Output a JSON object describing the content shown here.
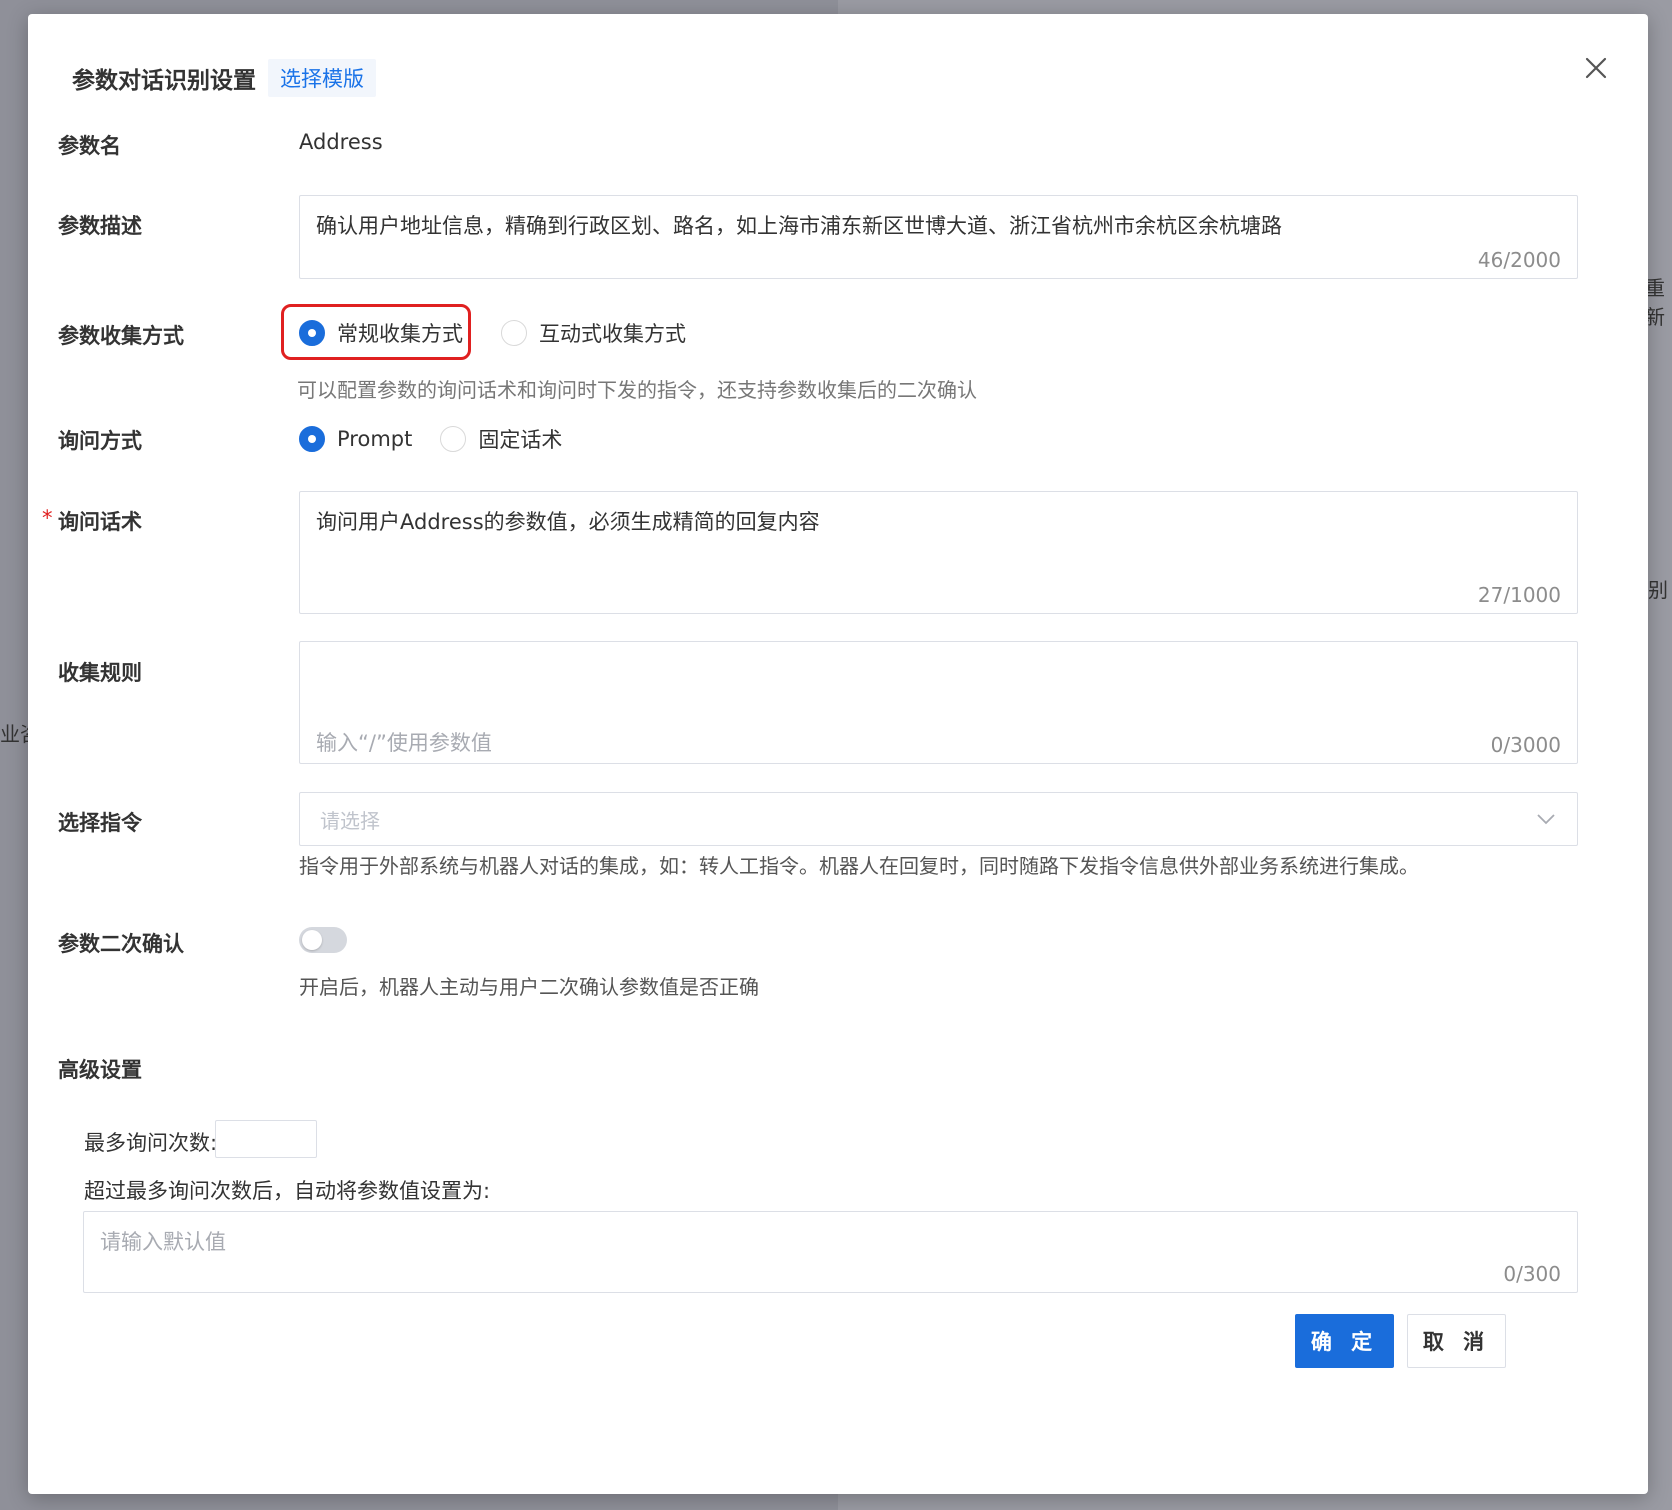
{
  "background": {
    "right_text_1": "重新",
    "right_text_2": "别",
    "left_text": "业咨"
  },
  "modal": {
    "title": "参数对话识别设置",
    "template_link": "选择模版",
    "close_icon": "close-icon"
  },
  "param_name": {
    "label": "参数名",
    "value": "Address"
  },
  "param_desc": {
    "label": "参数描述",
    "value": "确认用户地址信息，精确到行政区划、路名，如上海市浦东新区世博大道、浙江省杭州市余杭区余杭塘路",
    "counter": "46/2000"
  },
  "collect_method": {
    "label": "参数收集方式",
    "options": [
      "常规收集方式",
      "互动式收集方式"
    ],
    "selected_index": 0,
    "hint": "可以配置参数的询问话术和询问时下发的指令，还支持参数收集后的二次确认"
  },
  "ask_method": {
    "label": "询问方式",
    "options": [
      "Prompt",
      "固定话术"
    ],
    "selected_index": 0
  },
  "ask_script": {
    "required_mark": "*",
    "label": "询问话术",
    "value": "询问用户Address的参数值，必须生成精简的回复内容",
    "counter": "27/1000"
  },
  "collect_rule": {
    "label": "收集规则",
    "placeholder": "输入“/”使用参数值",
    "counter": "0/3000"
  },
  "select_command": {
    "label": "选择指令",
    "placeholder": "请选择",
    "hint": "指令用于外部系统与机器人对话的集成，如：转人工指令。机器人在回复时，同时随路下发指令信息供外部业务系统进行集成。"
  },
  "second_confirm": {
    "label": "参数二次确认",
    "enabled": false,
    "hint": "开启后，机器人主动与用户二次确认参数值是否正确"
  },
  "advanced": {
    "title": "高级设置",
    "max_ask_label": "最多询问次数:",
    "max_ask_value": "",
    "overflow_label": "超过最多询问次数后，自动将参数值设置为:",
    "default_placeholder": "请输入默认值",
    "default_counter": "0/300"
  },
  "footer": {
    "confirm": "确 定",
    "cancel": "取 消"
  },
  "colors": {
    "primary": "#1a6ddb",
    "highlight": "#e02020",
    "link": "#1a73e8"
  }
}
